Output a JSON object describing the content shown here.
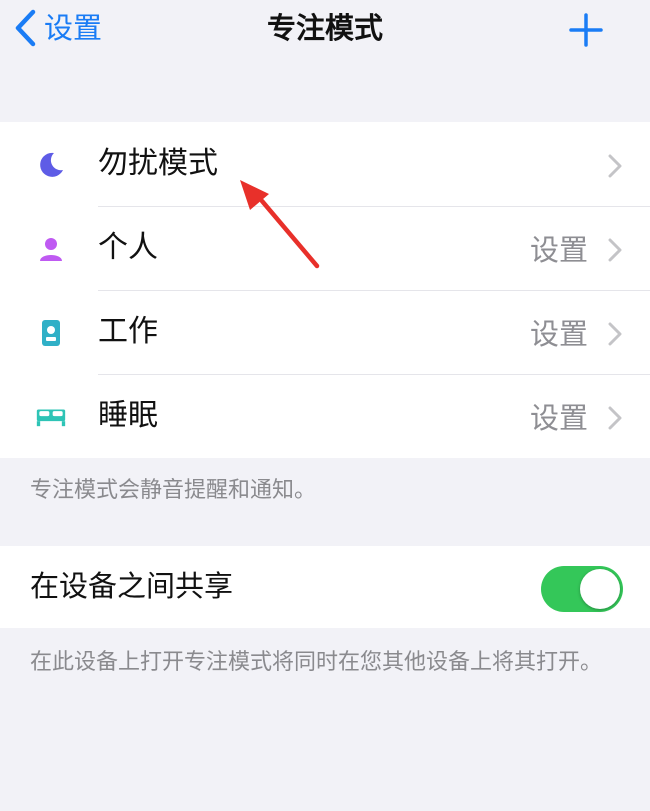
{
  "navbar": {
    "back_label": "设置",
    "title": "专注模式",
    "add_icon": "plus-icon"
  },
  "focus_modes": [
    {
      "label": "勿扰模式",
      "value": "",
      "icon": "moon-icon",
      "icon_color": "#5e5ce6"
    },
    {
      "label": "个人",
      "value": "设置",
      "icon": "person-icon",
      "icon_color": "#bf5af2"
    },
    {
      "label": "工作",
      "value": "设置",
      "icon": "id-badge-icon",
      "icon_color": "#30b0c7"
    },
    {
      "label": "睡眠",
      "value": "设置",
      "icon": "bed-icon",
      "icon_color": "#2ec4b6"
    }
  ],
  "focus_footer": "专注模式会静音提醒和通知。",
  "share": {
    "label": "在设备之间共享",
    "toggle_on": true,
    "toggle_color": "#34c759"
  },
  "share_footer": "在此设备上打开专注模式将同时在您其他设备上将其打开。",
  "colors": {
    "accent": "#1a7cf5",
    "annotation_arrow": "#e8302a"
  }
}
